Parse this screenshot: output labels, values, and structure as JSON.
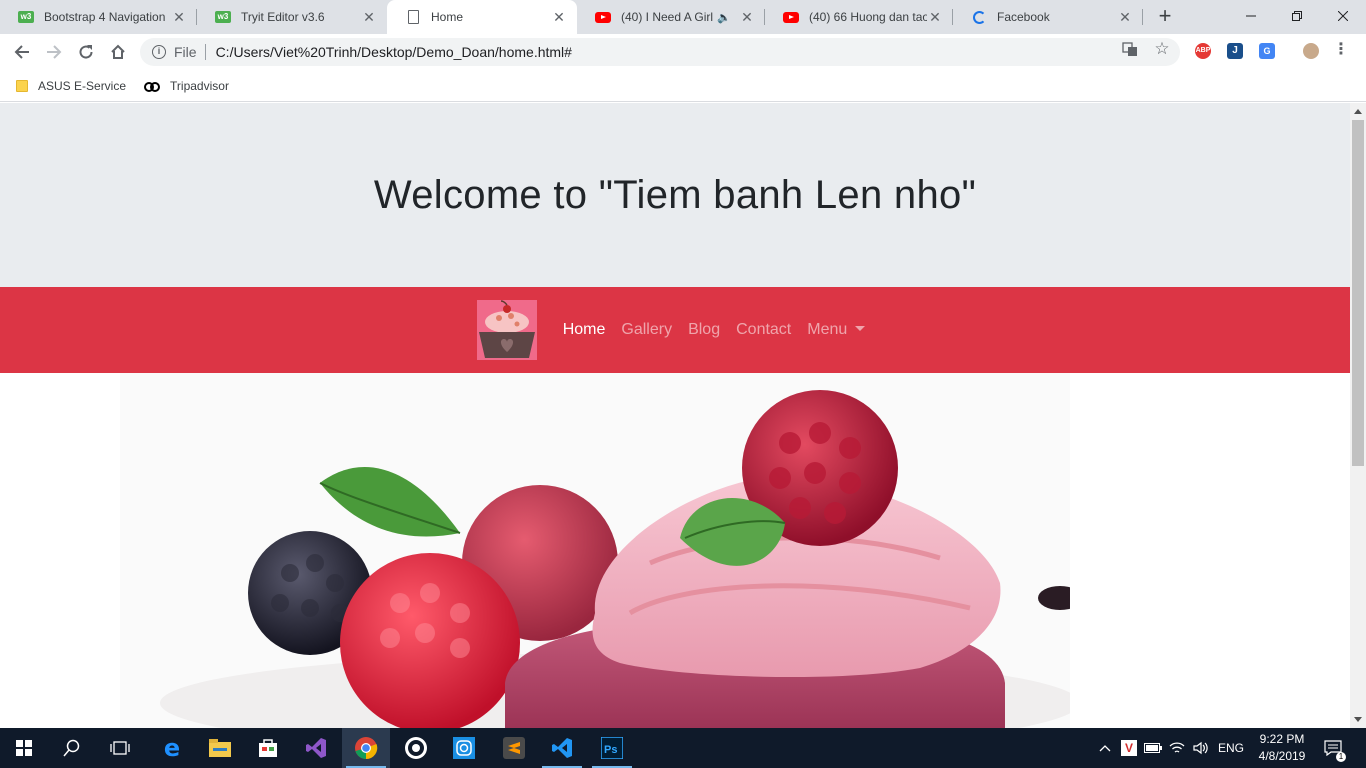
{
  "browser": {
    "tabs": [
      {
        "title": "Bootstrap 4 Navigation",
        "favicon": "w3schools-icon",
        "active": false
      },
      {
        "title": "Tryit Editor v3.6",
        "favicon": "w3schools-icon",
        "active": false
      },
      {
        "title": "Home",
        "favicon": "document-icon",
        "active": true
      },
      {
        "title": "(40) I Need A Girl -",
        "favicon": "youtube-icon",
        "active": false,
        "audio": true
      },
      {
        "title": "(40) 66 Huong dan tao",
        "favicon": "youtube-icon",
        "active": false
      },
      {
        "title": "Facebook",
        "favicon": "loading-spinner-icon",
        "active": false
      }
    ],
    "address": {
      "scheme_label": "File",
      "url": "C:/Users/Viet%20Trinh/Desktop/Demo_Doan/home.html#"
    },
    "bookmarks": [
      {
        "label": "ASUS E-Service",
        "icon": "folder-icon"
      },
      {
        "label": "Tripadvisor",
        "icon": "tripadvisor-owl-icon"
      }
    ],
    "extensions": [
      "adblock-plus-icon",
      "j-extension-icon",
      "google-translate-icon",
      "profile-avatar-icon"
    ]
  },
  "page": {
    "jumbotron": {
      "heading": "Welcome to \"Tiem banh Len nho\""
    },
    "navbar": {
      "brand_icon": "cupcake-logo-icon",
      "links": [
        {
          "label": "Home",
          "active": true
        },
        {
          "label": "Gallery",
          "active": false
        },
        {
          "label": "Blog",
          "active": false
        },
        {
          "label": "Contact",
          "active": false
        }
      ],
      "dropdown_label": "Menu"
    },
    "hero_image": "raspberry-cupcake-photo",
    "colors": {
      "jumbotron_bg": "#e9ecef",
      "navbar_bg": "#dc3545",
      "brand_bg": "#f06a8a"
    }
  },
  "taskbar": {
    "apps": [
      "start-icon",
      "search-icon",
      "task-view-icon",
      "edge-icon",
      "file-explorer-icon",
      "store-icon",
      "visual-studio-icon",
      "chrome-icon",
      "obs-icon",
      "instagram-icon",
      "sublime-text-icon",
      "vscode-icon",
      "photoshop-icon"
    ],
    "tray": {
      "language": "ENG",
      "time": "9:22 PM",
      "date": "4/8/2019",
      "notification_count": "1"
    }
  }
}
